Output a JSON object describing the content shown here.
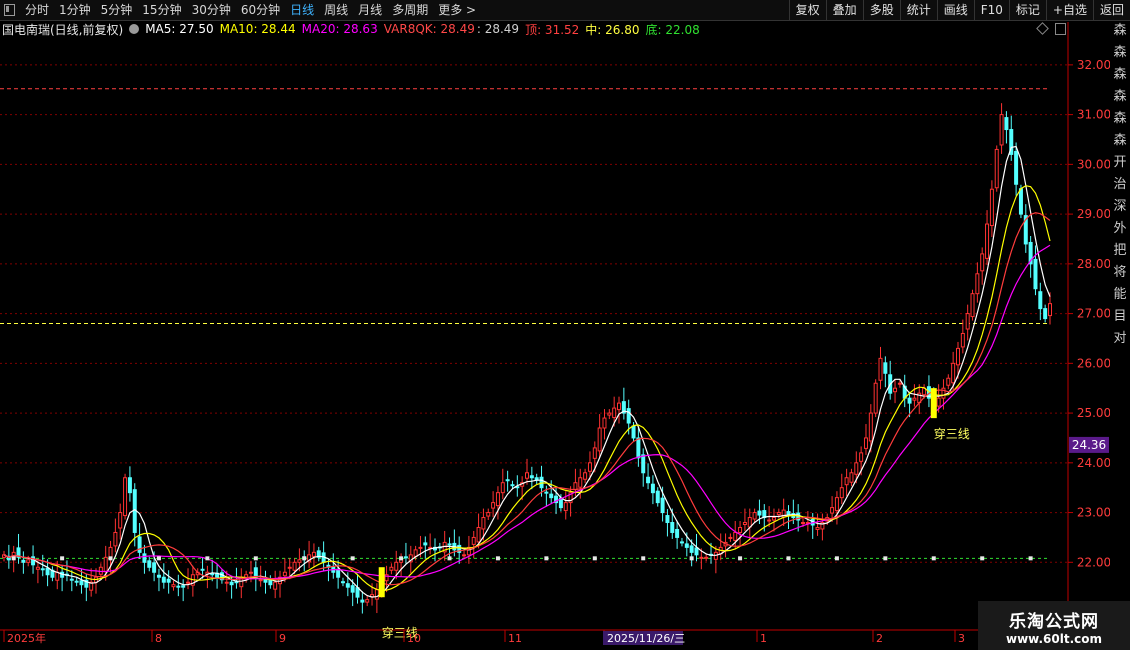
{
  "toolbar": {
    "periods": [
      "分时",
      "1分钟",
      "5分钟",
      "15分钟",
      "30分钟",
      "60分钟",
      "日线",
      "周线",
      "月线",
      "多周期",
      "更多 >"
    ],
    "active_period": "日线",
    "right_buttons": [
      "复权",
      "叠加",
      "多股",
      "统计",
      "画线",
      "F10",
      "标记",
      "+自选",
      "返回"
    ]
  },
  "info": {
    "stock": "国电南瑞(日线,前复权)",
    "ma5": "MA5: 27.50",
    "ma10": "MA10: 28.44",
    "ma20": "MA20: 28.63",
    "var": "VAR8QK: 28.49",
    "var2": ": 28.49",
    "top": "顶: 31.52",
    "mid": "中: 26.80",
    "bottom": "底: 22.08"
  },
  "colors": {
    "up": "#ff3232",
    "down": "#54ffff",
    "ma5": "#ffffff",
    "ma10": "#ffff00",
    "ma20": "#ff00ff",
    "var": "#ff3c3c",
    "top": "#ff4040",
    "mid": "#ffff40",
    "bottom": "#30e030",
    "grid": "#800000",
    "axis": "#c00000"
  },
  "right_strip": [
    "森",
    "森",
    "森",
    "森",
    "森",
    "森",
    "开",
    "治",
    "深",
    "外",
    "把",
    "将",
    "能",
    "目",
    "对"
  ],
  "watermark": {
    "line1": "乐淘公式网",
    "line2": "www.60lt.com"
  },
  "chart_data": {
    "type": "candlestick",
    "ylim": [
      20.8,
      32.5
    ],
    "yticks": [
      "32.00",
      "31.00",
      "30.00",
      "29.00",
      "28.00",
      "27.00",
      "26.00",
      "25.00",
      "24.00",
      "23.00",
      "22.00"
    ],
    "current_price": "24.36",
    "x_labels": [
      "2025年",
      "8",
      "9",
      "10",
      "11",
      "2025/11/26/三",
      "1",
      "2",
      "3"
    ],
    "levels": {
      "top": 31.52,
      "mid": 26.8,
      "bottom": 22.08
    },
    "annotations": [
      {
        "text": "穿三线",
        "index": 78
      },
      {
        "text": "穿三线",
        "index": 192
      }
    ],
    "closes": [
      22.15,
      22.05,
      22.2,
      22.1,
      22.0,
      22.05,
      21.95,
      21.9,
      21.85,
      21.75,
      21.7,
      21.8,
      21.7,
      21.75,
      21.65,
      21.6,
      21.55,
      21.5,
      21.6,
      21.7,
      21.9,
      22.1,
      22.3,
      22.6,
      23.0,
      23.7,
      23.4,
      22.6,
      22.2,
      22.0,
      21.9,
      21.8,
      21.7,
      21.6,
      21.6,
      21.55,
      21.5,
      21.5,
      21.6,
      21.75,
      21.8,
      21.85,
      21.8,
      21.75,
      21.7,
      21.65,
      21.6,
      21.55,
      21.6,
      21.7,
      21.75,
      21.8,
      21.7,
      21.65,
      21.6,
      21.55,
      21.6,
      21.7,
      21.8,
      21.9,
      22.0,
      22.05,
      22.1,
      22.15,
      22.2,
      22.1,
      22.0,
      21.9,
      21.8,
      21.7,
      21.6,
      21.5,
      21.4,
      21.3,
      21.2,
      21.25,
      21.35,
      21.45,
      21.6,
      21.75,
      21.9,
      22.0,
      22.05,
      22.1,
      22.15,
      22.25,
      22.3,
      22.35,
      22.3,
      22.25,
      22.3,
      22.4,
      22.35,
      22.25,
      22.2,
      22.15,
      22.3,
      22.5,
      22.7,
      22.9,
      23.0,
      23.2,
      23.4,
      23.6,
      23.65,
      23.55,
      23.5,
      23.6,
      23.8,
      23.7,
      23.65,
      23.5,
      23.4,
      23.3,
      23.2,
      23.1,
      23.2,
      23.4,
      23.6,
      23.7,
      23.8,
      24.0,
      24.3,
      24.7,
      24.9,
      25.0,
      25.1,
      25.2,
      25.0,
      24.8,
      24.5,
      24.1,
      23.8,
      23.6,
      23.4,
      23.2,
      23.0,
      22.8,
      22.6,
      22.5,
      22.4,
      22.3,
      22.2,
      22.15,
      22.1,
      22.1,
      22.15,
      22.2,
      22.3,
      22.4,
      22.5,
      22.6,
      22.7,
      22.8,
      22.9,
      23.0,
      22.95,
      22.9,
      22.85,
      22.9,
      23.0,
      23.05,
      22.95,
      22.9,
      22.85,
      22.8,
      22.8,
      22.75,
      22.7,
      22.8,
      22.9,
      23.1,
      23.3,
      23.5,
      23.7,
      23.8,
      24.0,
      24.2,
      24.5,
      25.0,
      25.6,
      26.1,
      25.8,
      25.4,
      25.5,
      25.6,
      25.3,
      25.2,
      25.3,
      25.4,
      25.5,
      25.3,
      25.2,
      25.3,
      25.5,
      25.7,
      26.0,
      26.3,
      26.6,
      27.0,
      27.4,
      27.8,
      28.2,
      28.8,
      29.5,
      30.3,
      31.0,
      30.7,
      30.2,
      29.6,
      29.0,
      28.4,
      28.0,
      27.5,
      27.1,
      26.9,
      27.2
    ]
  }
}
